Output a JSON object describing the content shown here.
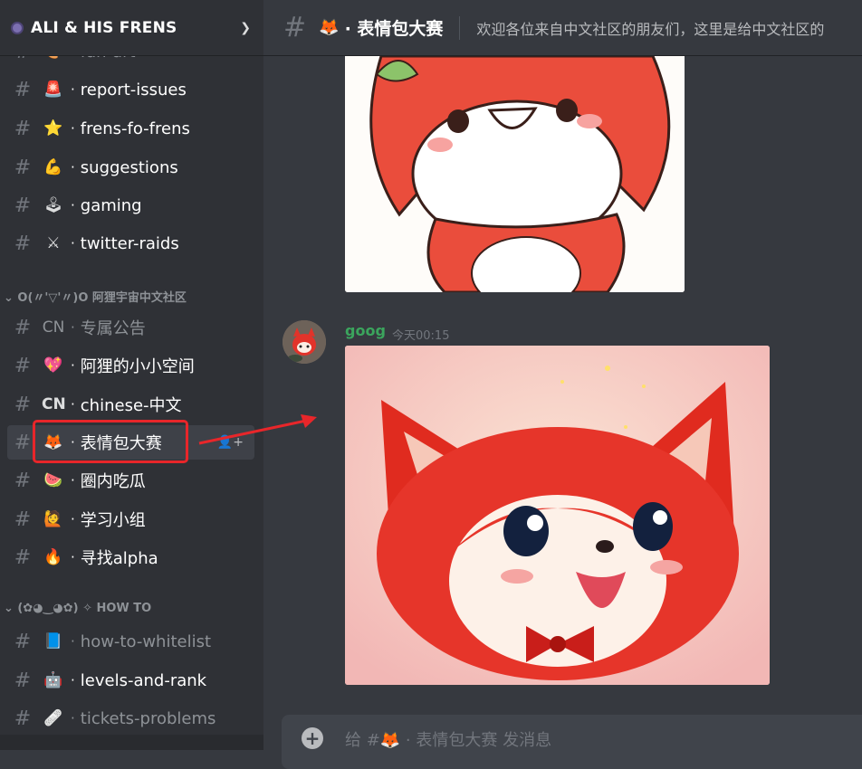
{
  "server": {
    "name": "ALI & HIS FRENS"
  },
  "sidebar": {
    "partial_top": {
      "label": "fan-art"
    },
    "channels_1": [
      {
        "emoji": "🚨",
        "label": "report-issues"
      },
      {
        "emoji": "⭐",
        "label": "frens-fo-frens"
      },
      {
        "emoji": "💪",
        "label": "suggestions"
      },
      {
        "emoji": "🕹",
        "label": "gaming"
      },
      {
        "emoji": "⚔",
        "label": "twitter-raids"
      }
    ],
    "category_chinese": "O(〃'▽'〃)O 阿狸宇宙中文社区",
    "channels_2": [
      {
        "tag": "CN",
        "label": "专属公告"
      },
      {
        "emoji": "💖",
        "label": "阿狸的小小空间"
      },
      {
        "tag": "CN",
        "label": "chinese-中文"
      },
      {
        "emoji": "🦊",
        "label": "表情包大赛"
      },
      {
        "emoji": "🍉",
        "label": "圈内吃瓜"
      },
      {
        "emoji": "🙋",
        "label": "学习小组"
      },
      {
        "emoji": "🔥",
        "label": "寻找alpha"
      }
    ],
    "category_howto": "(✿◕‿◕✿) ✧ HOW TO",
    "channels_3": [
      {
        "emoji": "📘",
        "label": "how-to-whitelist"
      },
      {
        "emoji": "🤖",
        "label": "levels-and-rank"
      },
      {
        "emoji": "🩹",
        "label": "tickets-problems"
      }
    ]
  },
  "chat": {
    "channel_emoji": "🦊",
    "channel_title": "· 表情包大赛",
    "topic": "欢迎各位来自中文社区的朋友们，这里是给中文社区的",
    "message": {
      "author": "goog",
      "timestamp": "今天00:15"
    },
    "input_placeholder": "给 #🦊 · 表情包大赛 发消息"
  },
  "colors": {
    "accent_green": "#3ba55d",
    "highlight_red": "#e8262a",
    "sidebar_bg": "#2f3136",
    "chat_bg": "#36393f"
  }
}
